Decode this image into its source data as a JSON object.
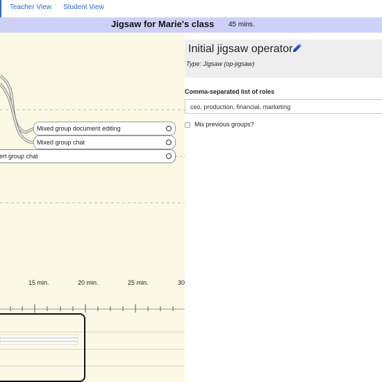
{
  "tabs": {
    "teacher": "Teacher View",
    "student": "Student View"
  },
  "graph": {
    "title": "Jigsaw for Marie's class",
    "duration": "45 mins."
  },
  "canvas": {
    "nodes": {
      "doc": "Mixed group document editing",
      "chat": "Mixed group chat",
      "expert": "ert group chat"
    },
    "timeline": {
      "t15": "15 min.",
      "t20": "20 min.",
      "t25": "25 min.",
      "t30": "30"
    }
  },
  "operator": {
    "title": "Initial jigsaw operator",
    "type": "Type: Jigsaw (op-jigsaw)",
    "roles_label": "Comma-separated list of roles",
    "roles_value": "ceo, production, financial, marketing",
    "mix_label": "Mix previous groups?"
  },
  "colors": {
    "accent": "#2b67c6",
    "title_bar": "#cdd1f7",
    "canvas": "#fbf9e6"
  }
}
